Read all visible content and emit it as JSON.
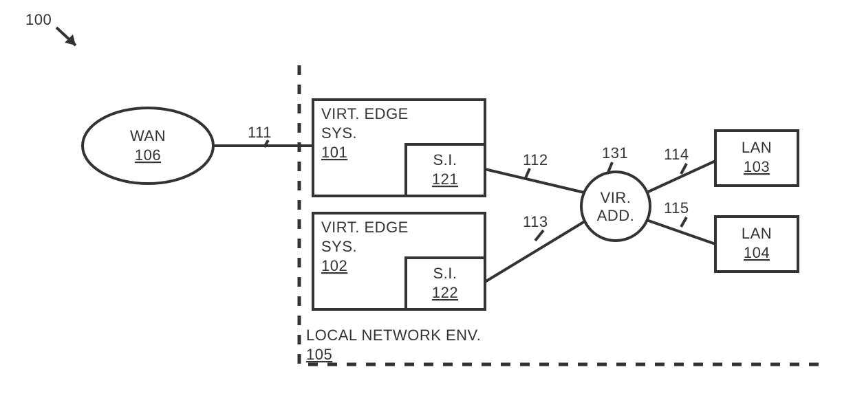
{
  "figure_ref": "100",
  "wan": {
    "label": "WAN",
    "ref": "106"
  },
  "local_env": {
    "label": "LOCAL NETWORK ENV.",
    "ref": "105"
  },
  "virt_edge_1": {
    "label1": "VIRT. EDGE",
    "label2": "SYS.",
    "ref": "101",
    "si_label": "S.I.",
    "si_ref": "121"
  },
  "virt_edge_2": {
    "label1": "VIRT. EDGE",
    "label2": "SYS.",
    "ref": "102",
    "si_label": "S.I.",
    "si_ref": "122"
  },
  "vir_add": {
    "label1": "VIR.",
    "label2": "ADD.",
    "ref": "131"
  },
  "lan_1": {
    "label": "LAN",
    "ref": "103"
  },
  "lan_2": {
    "label": "LAN",
    "ref": "104"
  },
  "links": {
    "wan_ves1": "111",
    "ves1_vir": "112",
    "ves2_vir": "113",
    "vir_lan1": "114",
    "vir_lan2": "115"
  }
}
